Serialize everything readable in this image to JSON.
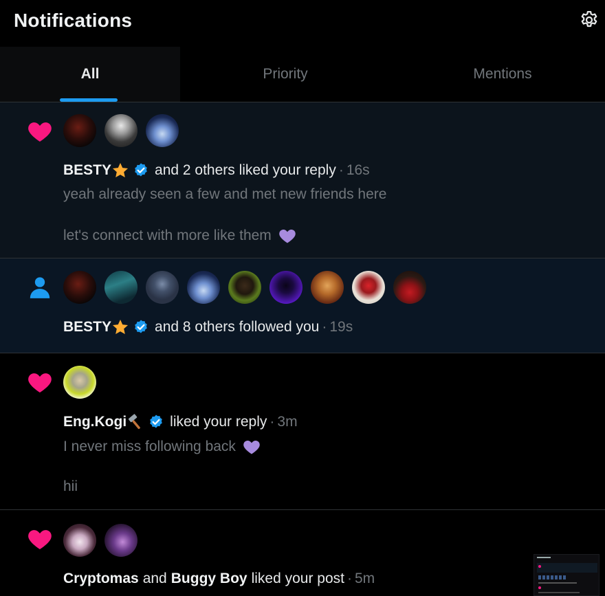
{
  "header": {
    "title": "Notifications",
    "settings_icon": "gear-icon"
  },
  "tabs": [
    {
      "label": "All",
      "selected": true
    },
    {
      "label": "Priority",
      "selected": false
    },
    {
      "label": "Mentions",
      "selected": false
    }
  ],
  "colors": {
    "accent": "#1d9bf0",
    "like": "#f91880",
    "follow": "#1d9bf0",
    "purple_heart": "#a78bde",
    "muted": "#71767b"
  },
  "notifications": [
    {
      "type": "like",
      "icon": "heart-icon",
      "actor": "BESTY",
      "actor_emoji": "star",
      "verified": true,
      "action": "and 2 others liked your reply",
      "separator": "·",
      "time": "16s",
      "text_line1": "yeah already seen a few and met new friends here",
      "text_line2": "let's connect with more like them",
      "text_emoji": "purple-heart"
    },
    {
      "type": "follow",
      "icon": "person-icon",
      "actor": "BESTY",
      "actor_emoji": "star",
      "verified": true,
      "action": "and 8 others followed you",
      "separator": "·",
      "time": "19s"
    },
    {
      "type": "like",
      "icon": "heart-icon",
      "actor": "Eng.Kogi",
      "actor_emoji": "hammer",
      "verified": true,
      "action": "liked your reply",
      "separator": "·",
      "time": "3m",
      "text_line1": "I never miss following back",
      "text_emoji": "purple-heart",
      "text_line2": "hii"
    },
    {
      "type": "like",
      "icon": "heart-icon",
      "actor": "Cryptomas",
      "conjunction": "and",
      "actor2": "Buggy Boy",
      "action": "liked your post",
      "separator": "·",
      "time": "5m"
    }
  ]
}
